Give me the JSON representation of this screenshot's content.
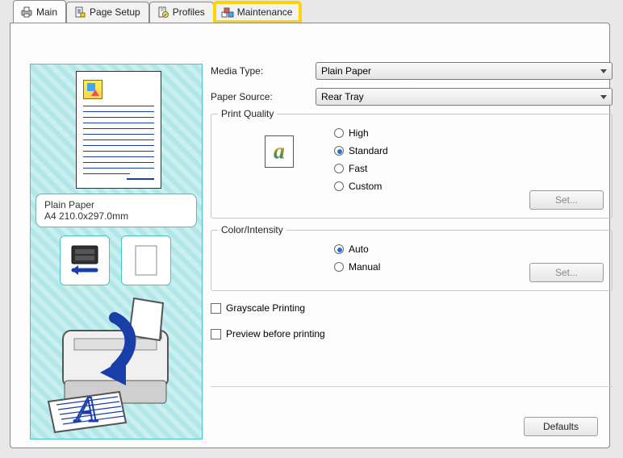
{
  "tabs": {
    "main": "Main",
    "page_setup": "Page Setup",
    "profiles": "Profiles",
    "maintenance": "Maintenance",
    "active": "main",
    "highlighted": "maintenance"
  },
  "form": {
    "media_type_label": "Media Type:",
    "media_type_value": "Plain Paper",
    "paper_source_label": "Paper Source:",
    "paper_source_value": "Rear Tray"
  },
  "preview": {
    "media_line1": "Plain Paper",
    "media_line2": "A4 210.0x297.0mm"
  },
  "quality": {
    "legend": "Print Quality",
    "options": {
      "high": "High",
      "standard": "Standard",
      "fast": "Fast",
      "custom": "Custom"
    },
    "selected": "standard",
    "set_label": "Set..."
  },
  "color": {
    "legend": "Color/Intensity",
    "options": {
      "auto": "Auto",
      "manual": "Manual"
    },
    "selected": "auto",
    "set_label": "Set..."
  },
  "checkboxes": {
    "grayscale": "Grayscale Printing",
    "preview": "Preview before printing"
  },
  "buttons": {
    "defaults": "Defaults"
  }
}
